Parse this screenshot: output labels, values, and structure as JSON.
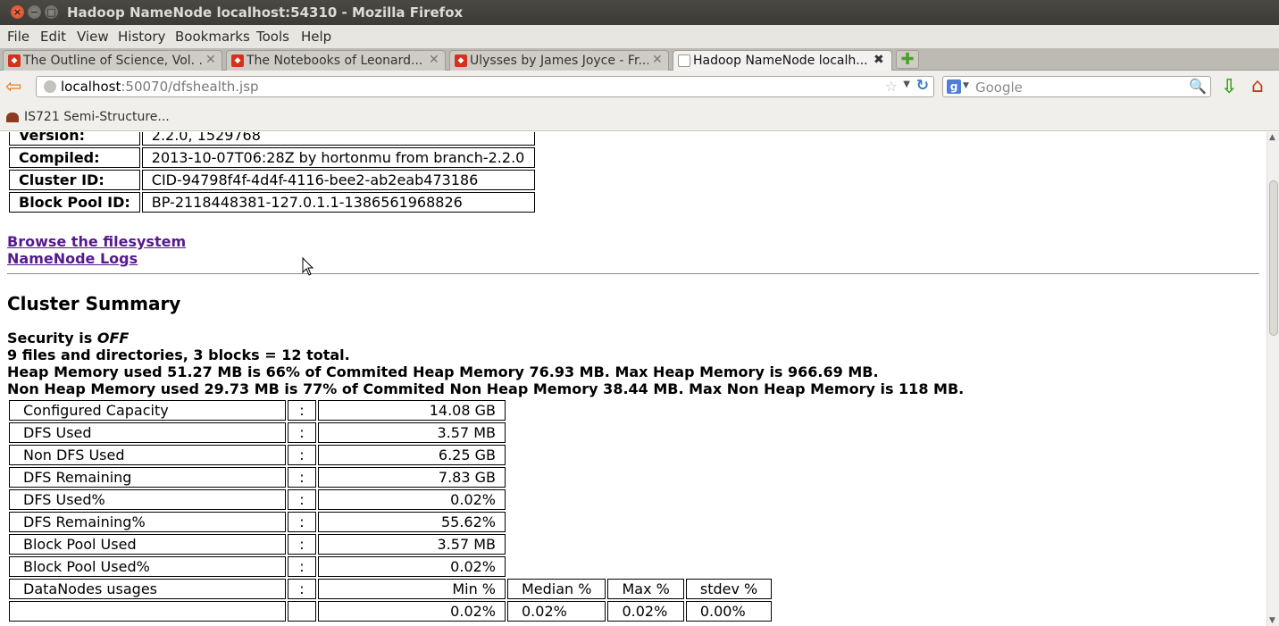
{
  "window": {
    "title": "Hadoop NameNode localhost:54310 - Mozilla Firefox",
    "close_glyph": "×",
    "min_glyph": "−",
    "max_glyph": "□"
  },
  "menu": [
    "File",
    "Edit",
    "View",
    "History",
    "Bookmarks",
    "Tools",
    "Help"
  ],
  "tabs": [
    {
      "label": "The Outline of Science, Vol. ...",
      "icon": "gutenberg-icon"
    },
    {
      "label": "The Notebooks of Leonard...",
      "icon": "gutenberg-icon"
    },
    {
      "label": "Ulysses by James Joyce - Fr...",
      "icon": "gutenberg-icon"
    },
    {
      "label": "Hadoop NameNode localh...",
      "icon": "blank-page-icon",
      "active": true
    }
  ],
  "tab_close_glyph": "✕",
  "tab_active_close_glyph": "✖",
  "new_tab_glyph": "✚",
  "nav": {
    "back_glyph": "⇦",
    "url_host": "localhost",
    "url_rest": ":50070/dfshealth.jsp",
    "star_glyph": "☆",
    "drop_glyph": "▼",
    "reload_glyph": "↻",
    "search_engine_letter": "g",
    "search_placeholder": "Google",
    "search_glyph": "🔍",
    "download_glyph": "⇩",
    "home_glyph": "⌂"
  },
  "bookmarks": [
    {
      "label": "IS721 Semi-Structure..."
    }
  ],
  "scrollbar": {
    "up_glyph": "▲",
    "down_glyph": "▼"
  },
  "info_table": [
    {
      "key": "Version:",
      "value": "2.2.0, 1529768"
    },
    {
      "key": "Compiled:",
      "value": "2013-10-07T06:28Z by hortonmu from branch-2.2.0"
    },
    {
      "key": "Cluster ID:",
      "value": "CID-94798f4f-4d4f-4116-bee2-ab2eab473186"
    },
    {
      "key": "Block Pool ID:",
      "value": "BP-2118448381-127.0.1.1-1386561968826"
    }
  ],
  "links": {
    "browse": "Browse the filesystem",
    "logs": "NameNode Logs"
  },
  "cluster_summary": {
    "title": "Cluster Summary",
    "security_prefix": "Security is ",
    "security_value": "OFF",
    "files_line": "9 files and directories, 3 blocks = 12 total.",
    "heap_line": "Heap Memory used 51.27 MB is 66% of Commited Heap Memory 76.93 MB. Max Heap Memory is 966.69 MB.",
    "nonheap_line": "Non Heap Memory used 29.73 MB is 77% of Commited Non Heap Memory 38.44 MB. Max Non Heap Memory is 118 MB.",
    "separator": ":",
    "rows": [
      {
        "label": "Configured Capacity",
        "value": "14.08 GB"
      },
      {
        "label": "DFS Used",
        "value": "3.57 MB"
      },
      {
        "label": "Non DFS Used",
        "value": "6.25 GB"
      },
      {
        "label": "DFS Remaining",
        "value": "7.83 GB"
      },
      {
        "label": "DFS Used%",
        "value": "0.02%"
      },
      {
        "label": "DFS Remaining%",
        "value": "55.62%"
      },
      {
        "label": "Block Pool Used",
        "value": "3.57 MB"
      },
      {
        "label": "Block Pool Used%",
        "value": "0.02%"
      }
    ],
    "datanodes": {
      "label": "DataNodes usages",
      "headers": [
        "Min %",
        "Median %",
        "Max %",
        "stdev %"
      ],
      "values": [
        "0.02%",
        "0.02%",
        "0.02%",
        "0.00%"
      ]
    }
  }
}
